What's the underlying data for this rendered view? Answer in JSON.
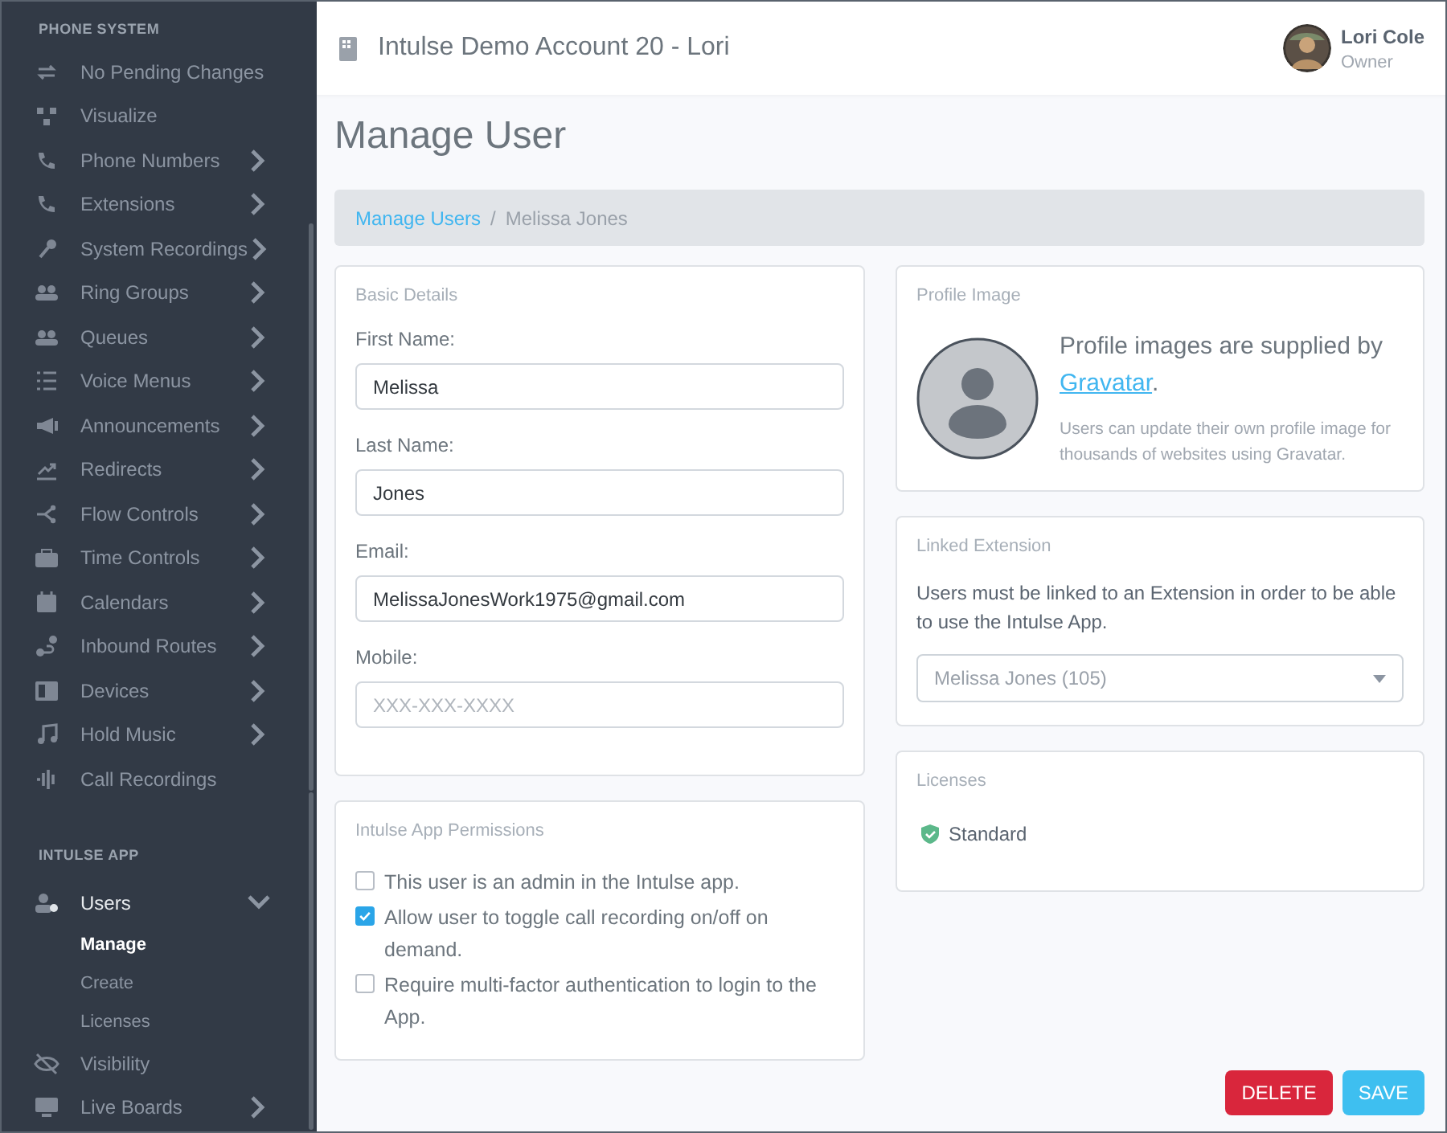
{
  "sidebar": {
    "sections": [
      {
        "heading": "PHONE SYSTEM",
        "items": [
          {
            "label": "No Pending Changes",
            "expandable": false
          },
          {
            "label": "Visualize",
            "expandable": false
          },
          {
            "label": "Phone Numbers",
            "expandable": true
          },
          {
            "label": "Extensions",
            "expandable": true
          },
          {
            "label": "System Recordings",
            "expandable": true
          },
          {
            "label": "Ring Groups",
            "expandable": true
          },
          {
            "label": "Queues",
            "expandable": true
          },
          {
            "label": "Voice Menus",
            "expandable": true
          },
          {
            "label": "Announcements",
            "expandable": true
          },
          {
            "label": "Redirects",
            "expandable": true
          },
          {
            "label": "Flow Controls",
            "expandable": true
          },
          {
            "label": "Time Controls",
            "expandable": true
          },
          {
            "label": "Calendars",
            "expandable": true
          },
          {
            "label": "Inbound Routes",
            "expandable": true
          },
          {
            "label": "Devices",
            "expandable": true
          },
          {
            "label": "Hold Music",
            "expandable": true
          },
          {
            "label": "Call Recordings",
            "expandable": false
          }
        ]
      },
      {
        "heading": "INTULSE APP",
        "items": [
          {
            "label": "Users",
            "expandable": true,
            "expanded": true,
            "children": [
              {
                "label": "Manage",
                "selected": true
              },
              {
                "label": "Create",
                "selected": false
              },
              {
                "label": "Licenses",
                "selected": false
              }
            ]
          },
          {
            "label": "Visibility",
            "expandable": false
          },
          {
            "label": "Live Boards",
            "expandable": true
          }
        ]
      }
    ]
  },
  "header": {
    "account": "Intulse Demo Account 20 - Lori",
    "user_name": "Lori Cole",
    "user_role": "Owner"
  },
  "page_title": "Manage User",
  "breadcrumb": [
    {
      "label": "Manage Users",
      "kind": "link"
    },
    {
      "label": "/",
      "kind": "separator"
    },
    {
      "label": "Melissa Jones",
      "kind": "current"
    }
  ],
  "basic_details": {
    "title": "Basic Details",
    "fields": [
      {
        "label": "First Name:",
        "value": "Melissa"
      },
      {
        "label": "Last Name:",
        "value": "Jones"
      },
      {
        "label": "Email:",
        "value": "MelissaJonesWork1975@gmail.com"
      },
      {
        "label": "Mobile:",
        "placeholder": "XXX-XXX-XXXX"
      }
    ]
  },
  "permissions": {
    "title": "Intulse App Permissions",
    "options": [
      {
        "label": "This user is an admin in the Intulse app.",
        "checked": false
      },
      {
        "label": "Allow user to toggle call recording on/off on demand.",
        "checked": true
      },
      {
        "label": "Require multi-factor authentication to login to the App.",
        "checked": false
      }
    ]
  },
  "profile_image": {
    "title": "Profile Image",
    "lead": "Profile images are supplied by",
    "link": "Gravatar",
    "after_link": ".",
    "note": "Users can update their own profile image for thousands of websites using Gravatar."
  },
  "linked_extension": {
    "title": "Linked Extension",
    "text": "Users must be linked to an Extension in order to be able to use the Intulse App.",
    "select_value": "Melissa Jones (105)"
  },
  "licenses": {
    "title": "Licenses",
    "items": [
      "Standard"
    ]
  },
  "buttons": [
    {
      "label": "DELETE",
      "kind": "danger"
    },
    {
      "label": "SAVE",
      "kind": "primary"
    }
  ]
}
